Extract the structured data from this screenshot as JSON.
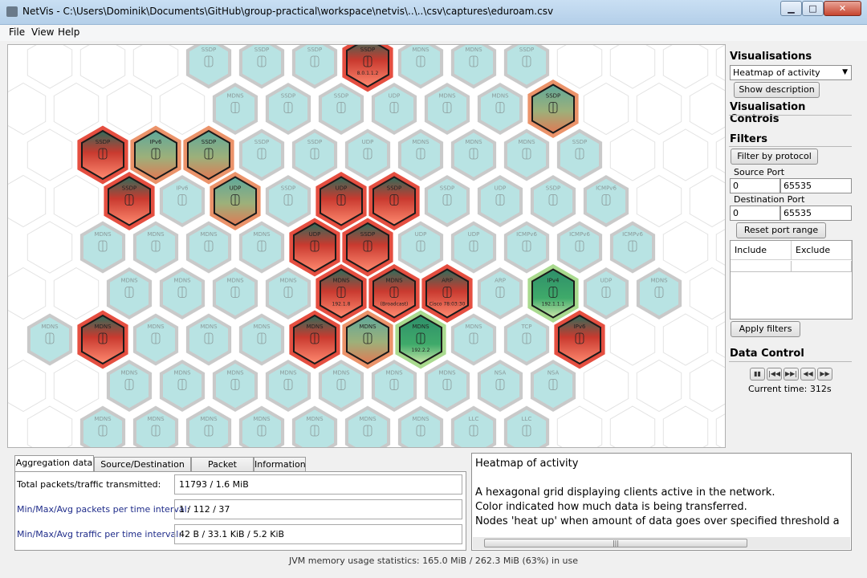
{
  "window": {
    "title": "NetVis - C:\\Users\\Dominik\\Documents\\GitHub\\group-practical\\workspace\\netvis\\..\\..\\csv\\captures\\eduroam.csv",
    "minimize": "▁",
    "maximize": "□",
    "close": "✕"
  },
  "menu": {
    "file": "File",
    "view": "View",
    "help": "Help"
  },
  "sidebar": {
    "visualisations_title": "Visualisations",
    "visualisation_selected": "Heatmap of activity",
    "show_description": "Show description",
    "controls_title": "Visualisation Controls",
    "filters_title": "Filters",
    "filter_by_protocol": "Filter by protocol",
    "source_port_label": "Source Port",
    "source_port_min": "0",
    "source_port_max": "65535",
    "dest_port_label": "Destination Port",
    "dest_port_min": "0",
    "dest_port_max": "65535",
    "reset_port_range": "Reset port range",
    "include_header": "Include",
    "exclude_header": "Exclude",
    "apply_filters": "Apply filters",
    "data_control_title": "Data Control",
    "current_time": "Current time: 312s"
  },
  "tabs": [
    {
      "label": "Aggregation data",
      "active": true
    },
    {
      "label": "Source/Destination info",
      "active": false
    },
    {
      "label": "Packet details",
      "active": false
    },
    {
      "label": "Information",
      "active": false
    }
  ],
  "aggregation": {
    "rows": [
      {
        "label": "Total packets/traffic transmitted:",
        "value": "11793 / 1.6 MiB"
      },
      {
        "label": "Min/Max/Avg packets per time interval:",
        "value": "1 / 112 / 37"
      },
      {
        "label": "Min/Max/Avg traffic per time interval:",
        "value": "42 B / 33.1 KiB / 5.2 KiB"
      }
    ]
  },
  "description": {
    "lines": [
      "Heatmap of activity",
      "",
      "A hexagonal grid displaying clients active in the network.",
      "Color indicated how much data is being transferred.",
      "Nodes 'heat up' when amount of data goes over specified threshold a"
    ]
  },
  "status": "JVM memory usage statistics: 165.0 MiB / 262.3 MiB (63%) in use",
  "heatmap": {
    "rows": [
      [
        "SSDP",
        "SSDP",
        "SSDP",
        "SSDP",
        "MDNS",
        "MDNS",
        "SSDP"
      ],
      [
        "MDNS",
        "SSDP",
        "SSDP",
        "UDP",
        "MDNS",
        "MDNS",
        "SSDP"
      ],
      [
        "SSDP",
        "IPv6",
        "SSDP",
        "SSDP",
        "SSDP",
        "UDP",
        "MDNS",
        "MDNS",
        "MDNS",
        "SSDP"
      ],
      [
        "SSDP",
        "IPv6",
        "UDP",
        "SSDP",
        "UDP",
        "SSDP",
        "SSDP",
        "UDP",
        "SSDP",
        "ICMPv6"
      ],
      [
        "MDNS",
        "MDNS",
        "MDNS",
        "MDNS",
        "UDP",
        "SSDP",
        "UDP",
        "UDP",
        "ICMPv6",
        "ICMPv6",
        "ICMPv6"
      ],
      [
        "MDNS",
        "MDNS",
        "MDNS",
        "MDNS",
        "MDNS",
        "MDNS",
        "ARP",
        "ARP",
        "IPv4",
        "UDP",
        "MDNS"
      ],
      [
        "MDNS",
        "MDNS",
        "MDNS",
        "MDNS",
        "MDNS",
        "MDNS",
        "MDNS",
        "MDNS",
        "MDNS",
        "TCP",
        "IPv6"
      ],
      [
        "MDNS",
        "MDNS",
        "MDNS",
        "MDNS",
        "MDNS",
        "MDNS",
        "MDNS",
        "NSA",
        "NSA"
      ],
      [
        "MDNS",
        "MDNS",
        "MDNS",
        "MDNS",
        "MDNS",
        "MDNS",
        "MDNS",
        "LLC",
        "LLC"
      ]
    ],
    "highlights": [
      {
        "row": 0,
        "col": 3,
        "heat": "red",
        "detail": "8.0.1.1.2"
      },
      {
        "row": 1,
        "col": 6,
        "heat": "green-red",
        "detail": ""
      },
      {
        "row": 2,
        "col": 0,
        "heat": "red",
        "detail": ""
      },
      {
        "row": 2,
        "col": 1,
        "heat": "green-red",
        "detail": ""
      },
      {
        "row": 2,
        "col": 2,
        "heat": "green-red",
        "detail": ""
      },
      {
        "row": 3,
        "col": 0,
        "heat": "red",
        "detail": ""
      },
      {
        "row": 3,
        "col": 2,
        "heat": "green-red",
        "detail": ""
      },
      {
        "row": 3,
        "col": 4,
        "heat": "red",
        "detail": ""
      },
      {
        "row": 3,
        "col": 5,
        "heat": "red",
        "detail": ""
      },
      {
        "row": 4,
        "col": 4,
        "heat": "red",
        "detail": ""
      },
      {
        "row": 4,
        "col": 5,
        "heat": "red",
        "detail": ""
      },
      {
        "row": 5,
        "col": 4,
        "heat": "red",
        "detail": "192.1.8"
      },
      {
        "row": 5,
        "col": 5,
        "heat": "red",
        "detail": "(Broadcast)"
      },
      {
        "row": 5,
        "col": 6,
        "heat": "red",
        "detail": "Cisco 78:03:30"
      },
      {
        "row": 5,
        "col": 8,
        "heat": "green",
        "detail": "192.1.1.1"
      },
      {
        "row": 6,
        "col": 1,
        "heat": "red",
        "detail": ""
      },
      {
        "row": 6,
        "col": 5,
        "heat": "red",
        "detail": ""
      },
      {
        "row": 6,
        "col": 6,
        "heat": "green-red",
        "detail": ""
      },
      {
        "row": 6,
        "col": 7,
        "heat": "green",
        "detail": "192.2.2"
      },
      {
        "row": 6,
        "col": 10,
        "heat": "red",
        "detail": ""
      }
    ],
    "colors": {
      "idle_fill": "#b8e3e3",
      "idle_border": "#c9c9c9",
      "hot_red": "#c93a2f",
      "warm_green": "#3faa6a"
    }
  }
}
